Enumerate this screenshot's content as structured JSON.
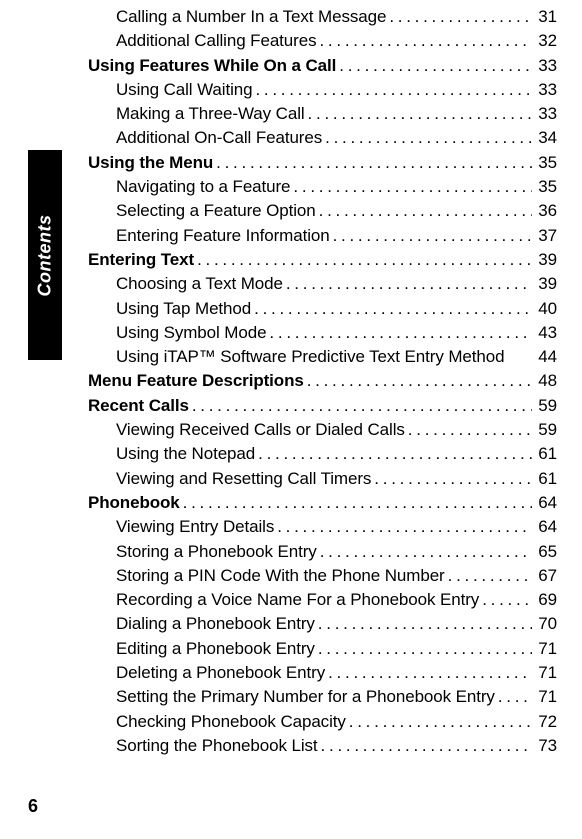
{
  "sideTab": {
    "label": "Contents"
  },
  "pageNumber": "6",
  "toc": [
    {
      "level": 2,
      "label": "Calling a Number In a Text Message",
      "page": "31"
    },
    {
      "level": 2,
      "label": "Additional Calling Features",
      "page": "32"
    },
    {
      "level": 1,
      "label": "Using Features While On a Call",
      "page": "33"
    },
    {
      "level": 2,
      "label": "Using Call Waiting",
      "page": "33"
    },
    {
      "level": 2,
      "label": "Making a Three-Way Call",
      "page": "33"
    },
    {
      "level": 2,
      "label": "Additional On-Call Features",
      "page": "34"
    },
    {
      "level": 1,
      "label": "Using the Menu",
      "page": "35"
    },
    {
      "level": 2,
      "label": "Navigating to a Feature",
      "page": "35"
    },
    {
      "level": 2,
      "label": "Selecting a Feature Option",
      "page": "36"
    },
    {
      "level": 2,
      "label": "Entering Feature Information",
      "page": "37"
    },
    {
      "level": 1,
      "label": "Entering Text",
      "page": "39"
    },
    {
      "level": 2,
      "label": "Choosing a Text Mode",
      "page": "39"
    },
    {
      "level": 2,
      "label": "Using Tap Method",
      "page": "40"
    },
    {
      "level": 2,
      "label": "Using Symbol Mode",
      "page": "43"
    },
    {
      "level": 2,
      "label": "Using iTAP™ Software Predictive Text Entry Method",
      "page": "44",
      "noDots": true
    },
    {
      "level": 1,
      "label": "Menu Feature Descriptions",
      "page": "48"
    },
    {
      "level": 1,
      "label": "Recent Calls",
      "page": "59"
    },
    {
      "level": 2,
      "label": "Viewing Received Calls or Dialed Calls",
      "page": "59"
    },
    {
      "level": 2,
      "label": "Using the Notepad",
      "page": "61"
    },
    {
      "level": 2,
      "label": "Viewing and Resetting Call Timers",
      "page": "61"
    },
    {
      "level": 1,
      "label": "Phonebook",
      "page": "64"
    },
    {
      "level": 2,
      "label": "Viewing Entry Details",
      "page": "64"
    },
    {
      "level": 2,
      "label": "Storing a Phonebook Entry",
      "page": "65"
    },
    {
      "level": 2,
      "label": "Storing a PIN Code With the Phone Number",
      "page": "67"
    },
    {
      "level": 2,
      "label": "Recording a Voice Name For a Phonebook Entry",
      "page": "69"
    },
    {
      "level": 2,
      "label": "Dialing a Phonebook Entry",
      "page": "70"
    },
    {
      "level": 2,
      "label": "Editing a Phonebook Entry",
      "page": "71"
    },
    {
      "level": 2,
      "label": "Deleting a Phonebook Entry",
      "page": "71"
    },
    {
      "level": 2,
      "label": "Setting the Primary Number for a Phonebook Entry",
      "page": "71"
    },
    {
      "level": 2,
      "label": "Checking Phonebook Capacity",
      "page": "72"
    },
    {
      "level": 2,
      "label": "Sorting the Phonebook List",
      "page": "73"
    }
  ]
}
